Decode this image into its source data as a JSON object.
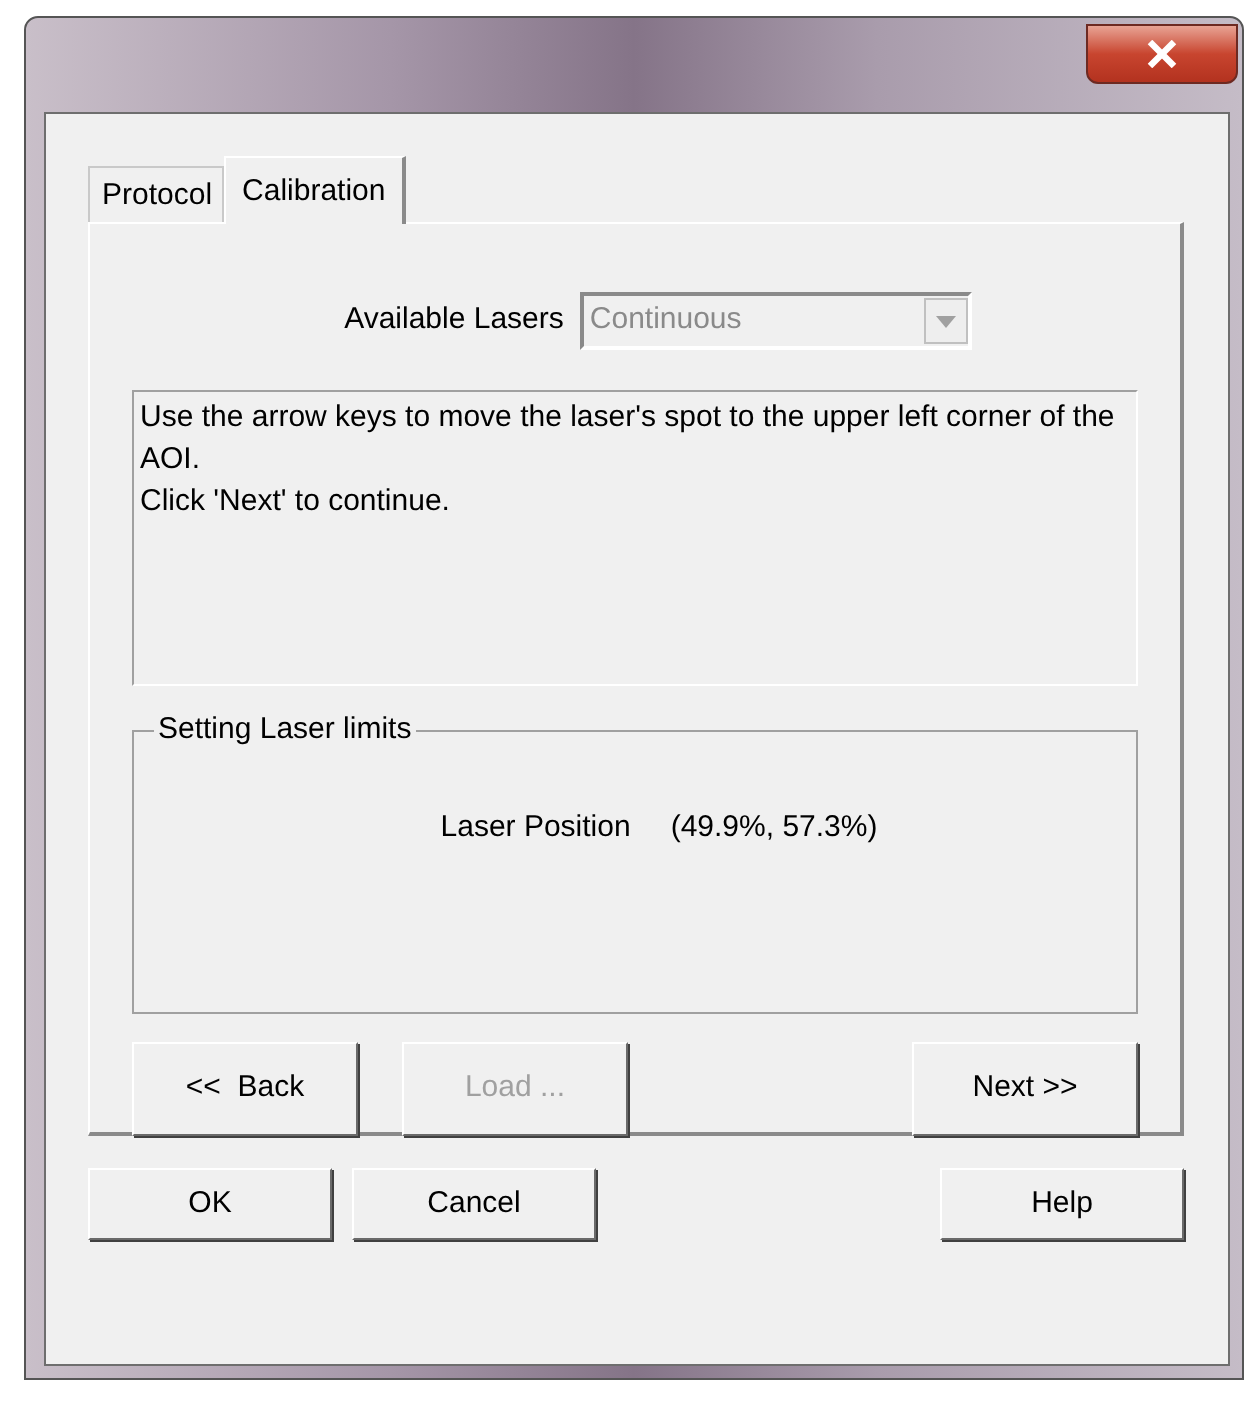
{
  "tabs": [
    {
      "label": "Protocol",
      "selected": false
    },
    {
      "label": "Calibration",
      "selected": true
    }
  ],
  "laser_select": {
    "label": "Available Lasers",
    "value": "Continuous",
    "disabled": true
  },
  "instructions": "Use the arrow keys to move the laser's spot to the upper left corner of the AOI.\nClick 'Next' to continue.",
  "limits_group": {
    "legend": "Setting Laser limits",
    "label": "Laser Position",
    "value": "(49.9%, 57.3%)"
  },
  "wizard_buttons": [
    {
      "label": "<<  Back",
      "disabled": false
    },
    {
      "label": "Load ...",
      "disabled": true
    },
    {
      "label": "Next >>",
      "disabled": false
    }
  ],
  "dialog_buttons": [
    {
      "label": "OK",
      "disabled": false
    },
    {
      "label": "Cancel",
      "disabled": false
    },
    {
      "label": "Help",
      "disabled": false
    }
  ]
}
